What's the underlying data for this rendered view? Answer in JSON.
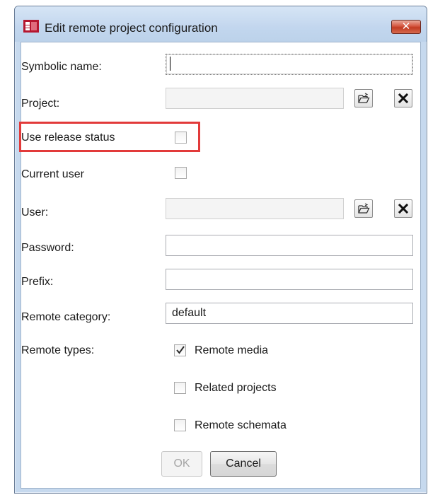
{
  "window": {
    "title": "Edit remote project configuration",
    "close_glyph": "✕"
  },
  "form": {
    "symbolic_name": {
      "label": "Symbolic name:",
      "value": ""
    },
    "project": {
      "label": "Project:",
      "value": ""
    },
    "use_release_status": {
      "label": "Use release status",
      "checked": false
    },
    "current_user": {
      "label": "Current user",
      "checked": false
    },
    "user": {
      "label": "User:",
      "value": ""
    },
    "password": {
      "label": "Password:",
      "value": ""
    },
    "prefix": {
      "label": "Prefix:",
      "value": ""
    },
    "remote_category": {
      "label": "Remote category:",
      "value": "default"
    },
    "remote_types": {
      "label": "Remote types:",
      "options": [
        {
          "label": "Remote media",
          "checked": true
        },
        {
          "label": "Related projects",
          "checked": false
        },
        {
          "label": "Remote schemata",
          "checked": false
        }
      ]
    }
  },
  "buttons": {
    "ok": "OK",
    "cancel": "Cancel"
  },
  "icons": {
    "browse": "folder-open-icon",
    "clear": "clear-x-icon",
    "app": "app-logo-icon"
  },
  "colors": {
    "highlight": "#e23a3a",
    "close_button": "#c23b22",
    "app_icon": "#b5162f"
  }
}
